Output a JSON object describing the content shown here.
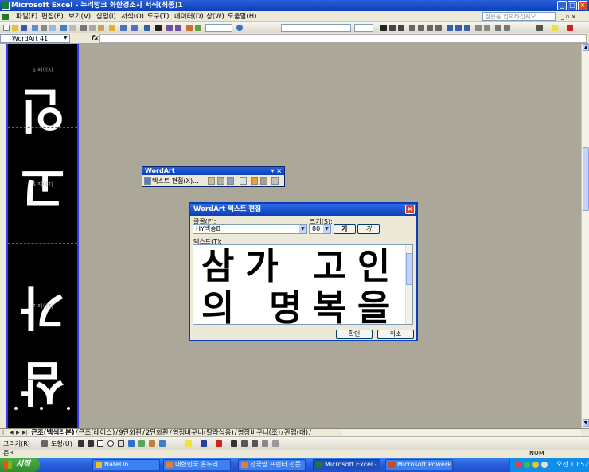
{
  "window": {
    "title": "Microsoft Excel - 누리망크 화한경조사 서식(최종)1"
  },
  "menu": {
    "items": [
      "파일(F)",
      "편집(E)",
      "보기(V)",
      "삽입(I)",
      "서식(O)",
      "도구(T)",
      "데이터(D)",
      "창(W)",
      "도움말(H)"
    ],
    "help_placeholder": "질문을 입력하십시오."
  },
  "formula_bar": {
    "name_box": "WordArt 41",
    "fx": "fx"
  },
  "wordart_preview": {
    "page_labels": [
      "5 페이지",
      "6 페이지",
      "7 페이지"
    ],
    "glyphs": [
      "삼",
      "가",
      "고",
      "인"
    ]
  },
  "wordart_toolbar": {
    "title": "WordArt",
    "edit_text_label": "텍스트 편집(X)..."
  },
  "dialog": {
    "title": "WordArt 텍스트 편집",
    "font_label": "글꼴(F):",
    "font_value": "HY백송B",
    "size_label": "크기(S):",
    "size_value": "80",
    "bold_label": "가",
    "italic_label": "가",
    "text_label": "텍스트(T):",
    "text_lines": [
      "삼가 고인",
      "의 명복을"
    ],
    "ok_label": "확인",
    "cancel_label": "취소"
  },
  "sheet_tabs": {
    "tabs": [
      "근조(백색리본)",
      "근조(레이스)",
      "9단화환",
      "2단화환",
      "영정비구니(칼라식용)",
      "영정비구니(조)",
      "관엽(대)"
    ],
    "active_index": 0
  },
  "drawing_toolbar": {
    "draw_label": "그리기(R)",
    "shapes_label": "도형(U)"
  },
  "status": {
    "left": "준비",
    "num": "NUM"
  },
  "taskbar": {
    "start_label": "시작",
    "items": [
      "NateOn",
      "대한민국 온누리...",
      "전국망 프린터 전문...",
      "Microsoft Excel -...",
      "Microsoft PowerP..."
    ],
    "active_index": 3,
    "clock": "오전 10:52"
  },
  "colors": {
    "xp_blue": "#0a3fb8",
    "wordart_bg": "#000000",
    "sheet_bg": "#aca899",
    "start_green": "#3c9a37"
  }
}
